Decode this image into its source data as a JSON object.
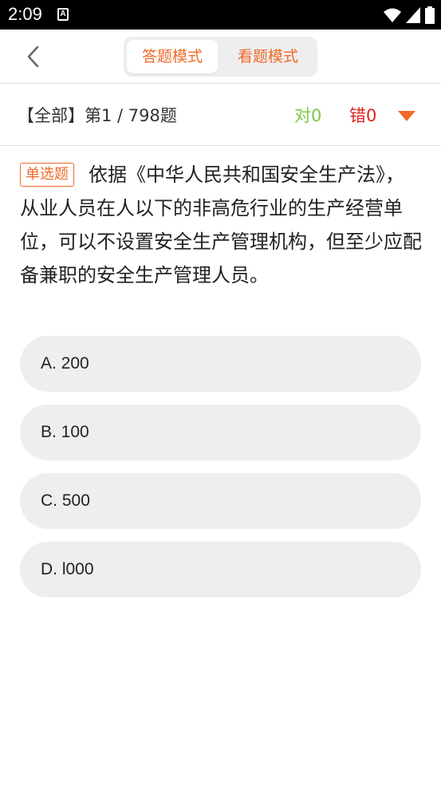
{
  "status_bar": {
    "time": "2:09",
    "notification_letter": "A"
  },
  "header": {
    "mode_tabs": [
      {
        "label": "答题模式",
        "active": true
      },
      {
        "label": "看题模式",
        "active": false
      }
    ]
  },
  "info": {
    "progress_text": "【全部】第1 / 798题",
    "correct_text": "对0",
    "wrong_text": "错0"
  },
  "question": {
    "type_label": "单选题",
    "text": "依据《中华人民共和国安全生产法》，从业人员在人以下的非高危行业的生产经营单位，可以不设置安全生产管理机构，但至少应配备兼职的安全生产管理人员。"
  },
  "options": [
    {
      "label": "A. 200"
    },
    {
      "label": "B. 100"
    },
    {
      "label": "C. 500"
    },
    {
      "label": "D. l000"
    }
  ],
  "colors": {
    "accent": "#f06a2a",
    "correct": "#7ac943",
    "wrong": "#e02020",
    "option_bg": "#eeeeee"
  }
}
